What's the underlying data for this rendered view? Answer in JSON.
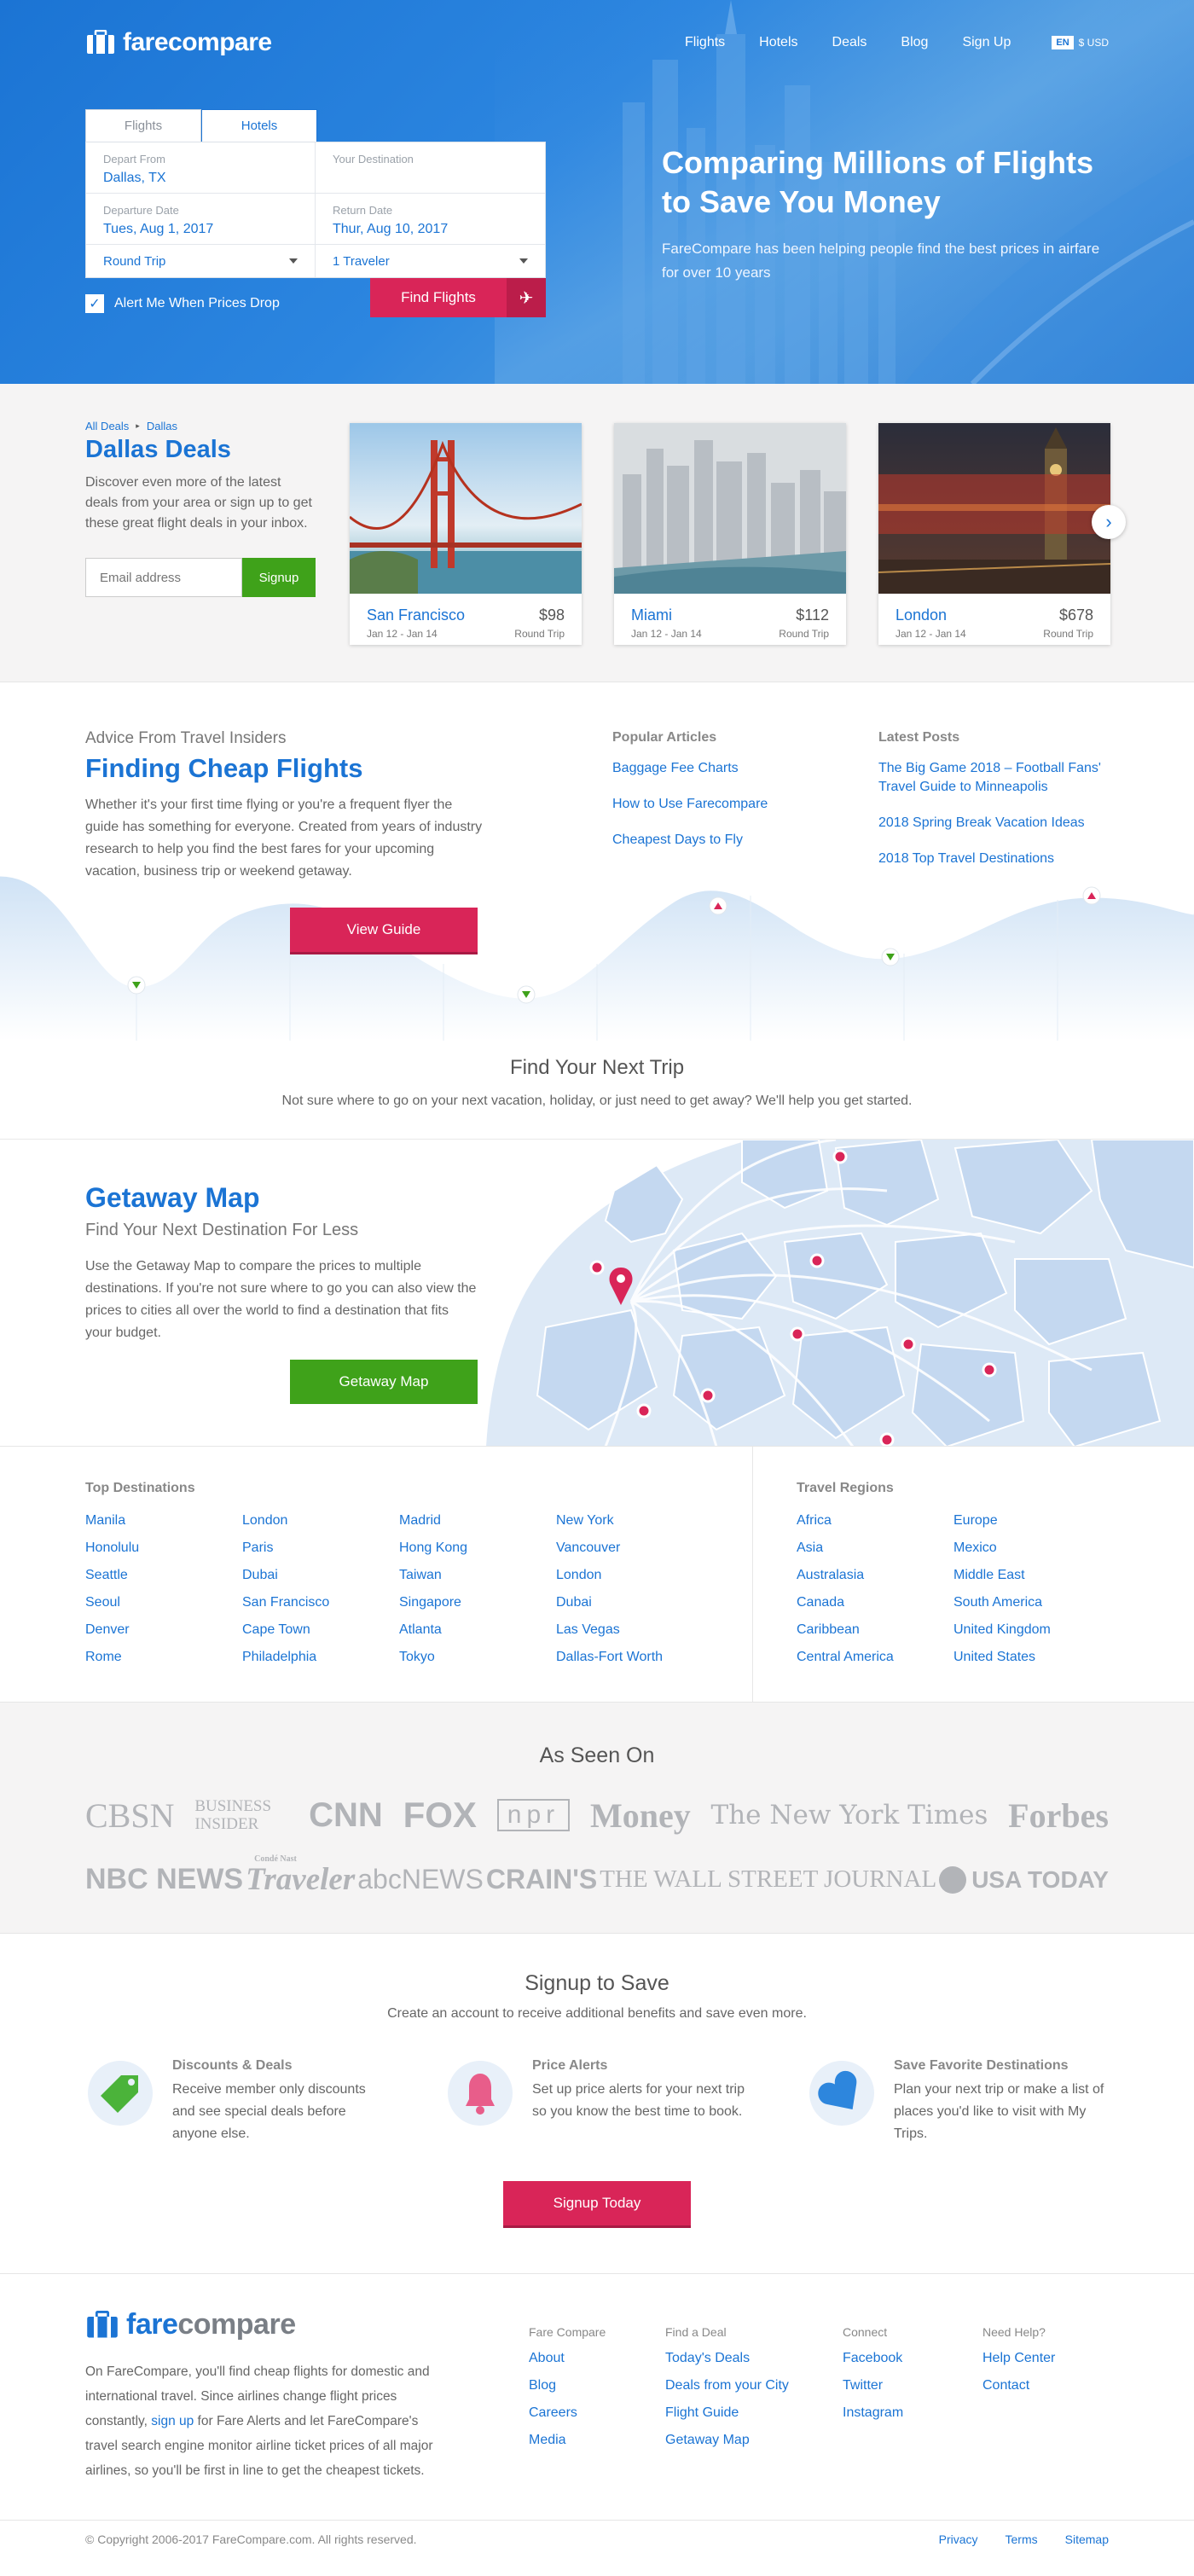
{
  "brand": {
    "name": "farecompare",
    "name_part1": "fare",
    "name_part2": "compare"
  },
  "nav": {
    "items": [
      {
        "label": "Flights"
      },
      {
        "label": "Hotels"
      },
      {
        "label": "Deals"
      },
      {
        "label": "Blog"
      },
      {
        "label": "Sign Up"
      }
    ],
    "language": "EN",
    "currency": "$ USD"
  },
  "search": {
    "tabs": [
      {
        "label": "Flights"
      },
      {
        "label": "Hotels"
      }
    ],
    "depart_label": "Depart From",
    "depart_value": "Dallas, TX",
    "destination_label": "Your Destination",
    "departure_date_label": "Departure Date",
    "departure_date_value": "Tues, Aug 1, 2017",
    "return_date_label": "Return Date",
    "return_date_value": "Thur, Aug 10, 2017",
    "trip_type": "Round Trip",
    "travelers": "1 Traveler",
    "alert_label": "Alert Me When Prices Drop",
    "find_button": "Find Flights"
  },
  "hero": {
    "headline": "Comparing Millions of Flights to Save You Money",
    "subtext": "FareCompare has been helping people find the best prices in airfare for over 10 years"
  },
  "deals": {
    "breadcrumb": [
      "All Deals",
      "Dallas"
    ],
    "title": "Dallas Deals",
    "description": "Discover even more of the latest deals from your area or sign up to get these great flight deals in your inbox.",
    "email_placeholder": "Email address",
    "signup_button": "Signup",
    "cards": [
      {
        "city": "San Francisco",
        "price": "$98",
        "dates": "Jan 12 - Jan 14",
        "trip": "Round Trip"
      },
      {
        "city": "Miami",
        "price": "$112",
        "dates": "Jan 12 - Jan 14",
        "trip": "Round Trip"
      },
      {
        "city": "London",
        "price": "$678",
        "dates": "Jan 12 - Jan 14",
        "trip": "Round Trip"
      }
    ]
  },
  "advice": {
    "kicker": "Advice From Travel Insiders",
    "title": "Finding Cheap Flights",
    "body": "Whether it's your first time flying or you're a frequent flyer the guide has something for everyone. Created from years of industry research to help you find the best fares for your upcoming vacation, business trip or weekend getaway.",
    "button": "View Guide",
    "popular_title": "Popular Articles",
    "popular": [
      {
        "label": "Baggage Fee Charts"
      },
      {
        "label": "How to Use Farecompare"
      },
      {
        "label": "Cheapest Days to Fly"
      }
    ],
    "latest_title": "Latest Posts",
    "latest": [
      {
        "label": "The Big Game 2018 – Football Fans' Travel Guide to Minneapolis"
      },
      {
        "label": "2018 Spring Break Vacation Ideas"
      },
      {
        "label": "2018 Top Travel Destinations"
      }
    ],
    "next_title": "Find Your Next Trip",
    "next_sub": "Not sure where to go on your next vacation, holiday, or just need to get away? We'll help you get started."
  },
  "getaway": {
    "title": "Getaway Map",
    "subtitle": "Find Your Next Destination For Less",
    "body": "Use the Getaway Map to compare the prices to multiple destinations. If you're not sure where to go you can also view the prices to cities all over the world to find a destination that fits your budget.",
    "button": "Getaway Map"
  },
  "destinations": {
    "title": "Top Destinations",
    "items": [
      {
        "label": "Manila"
      },
      {
        "label": "London"
      },
      {
        "label": "Madrid"
      },
      {
        "label": "New York"
      },
      {
        "label": "Honolulu"
      },
      {
        "label": "Paris"
      },
      {
        "label": "Hong Kong"
      },
      {
        "label": "Vancouver"
      },
      {
        "label": "Seattle"
      },
      {
        "label": "Dubai"
      },
      {
        "label": "Taiwan"
      },
      {
        "label": "London"
      },
      {
        "label": "Seoul"
      },
      {
        "label": "San Francisco"
      },
      {
        "label": "Singapore"
      },
      {
        "label": "Dubai"
      },
      {
        "label": "Denver"
      },
      {
        "label": "Cape Town"
      },
      {
        "label": "Atlanta"
      },
      {
        "label": "Las Vegas"
      },
      {
        "label": "Rome"
      },
      {
        "label": "Philadelphia"
      },
      {
        "label": "Tokyo"
      },
      {
        "label": "Dallas-Fort Worth"
      }
    ],
    "regions_title": "Travel Regions",
    "regions": [
      {
        "label": "Africa"
      },
      {
        "label": "Europe"
      },
      {
        "label": "Asia"
      },
      {
        "label": "Mexico"
      },
      {
        "label": "Australasia"
      },
      {
        "label": "Middle East"
      },
      {
        "label": "Canada"
      },
      {
        "label": "South America"
      },
      {
        "label": "Caribbean"
      },
      {
        "label": "United Kingdom"
      },
      {
        "label": "Central America"
      },
      {
        "label": "United States"
      }
    ]
  },
  "seen_on": {
    "title": "As Seen On",
    "row1": [
      "CBSN",
      "BUSINESS INSIDER",
      "CNN",
      "FOX",
      "npr",
      "Money",
      "The New York Times",
      "Forbes"
    ],
    "row2": [
      "NBC NEWS",
      "Traveler",
      "abcNEWS",
      "CRAIN'S",
      "THE WALL STREET JOURNAL",
      "USA TODAY"
    ],
    "traveler_small": "Condé Nast"
  },
  "signup": {
    "title": "Signup to Save",
    "subtitle": "Create an account to receive additional benefits and save even more.",
    "features": [
      {
        "title": "Discounts & Deals",
        "body": "Receive member only discounts and see special deals before anyone else."
      },
      {
        "title": "Price Alerts",
        "body": "Set up price alerts for your next trip so you know the best time to book."
      },
      {
        "title": "Save Favorite Destinations",
        "body": "Plan your next trip or make a list of places you'd like to visit with My Trips."
      }
    ],
    "button": "Signup Today"
  },
  "footer": {
    "about_1": "On FareCompare, you'll find cheap flights for domestic and international travel. Since airlines change flight prices constantly, ",
    "about_link": "sign up",
    "about_2": " for Fare Alerts and let FareCompare's travel search engine monitor airline ticket prices of all major airlines, so you'll be first in line to get the cheapest tickets.",
    "columns": [
      {
        "title": "Fare Compare",
        "links": [
          "About",
          "Blog",
          "Careers",
          "Media"
        ]
      },
      {
        "title": "Find a Deal",
        "links": [
          "Today's Deals",
          "Deals from your City",
          "Flight Guide",
          "Getaway Map"
        ]
      },
      {
        "title": "Connect",
        "links": [
          "Facebook",
          "Twitter",
          "Instagram"
        ]
      },
      {
        "title": "Need Help?",
        "links": [
          "Help Center",
          "Contact"
        ]
      }
    ],
    "copyright": "© Copyright 2006-2017 FareCompare.com. All rights reserved.",
    "bottom_links": [
      "Privacy",
      "Terms",
      "Sitemap"
    ]
  },
  "colors": {
    "brand_blue": "#1b74d4",
    "accent_pink": "#d92558",
    "accent_green": "#3fa21a"
  }
}
